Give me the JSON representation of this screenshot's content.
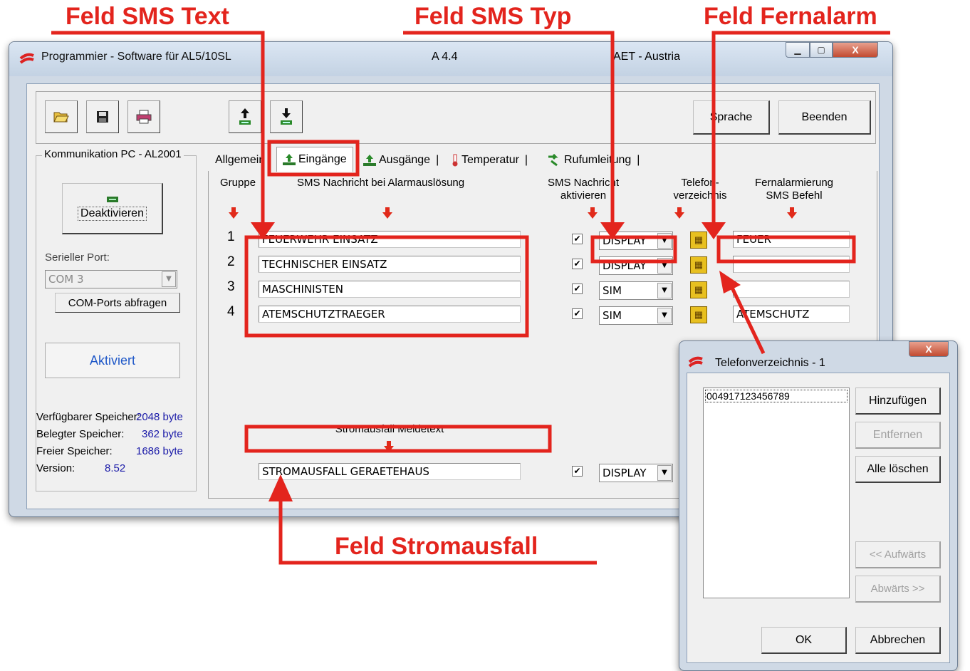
{
  "callouts": {
    "sms_text": "Feld SMS Text",
    "sms_typ": "Feld SMS Typ",
    "fernalarm": "Feld Fernalarm",
    "stromausfall": "Feld Stromausfall"
  },
  "colors": {
    "accent_red": "#e3241d",
    "value_blue": "#1a1aa8"
  },
  "window": {
    "title": "Programmier - Software für AL5/10SL",
    "version": "A 4.4",
    "vendor": "AET - Austria",
    "caption_icons": [
      "minimize-icon",
      "maximize-icon",
      "close-icon"
    ],
    "caption_close": "X"
  },
  "toolbar": {
    "icons": [
      "open-folder-icon",
      "save-disk-icon",
      "print-icon",
      "upload-icon",
      "download-icon"
    ],
    "sprache": "Sprache",
    "beenden": "Beenden"
  },
  "left": {
    "group_title": "Kommunikation PC - AL2001",
    "deaktivieren": "Deaktivieren",
    "port_label": "Serieller Port:",
    "port_value": "COM 3",
    "ports_button": "COM-Ports abfragen",
    "status": "Aktiviert",
    "mem": [
      {
        "label": "Verfügbarer Speicher:",
        "value": "2048 byte"
      },
      {
        "label": "Belegter Speicher:",
        "value": "362 byte"
      },
      {
        "label": "Freier Speicher:",
        "value": "1686 byte"
      },
      {
        "label": "Version:",
        "value": "8.52"
      }
    ]
  },
  "tabs": [
    "Allgemein",
    "Eingänge",
    "Ausgänge",
    "Temperatur",
    "Rufumleitung"
  ],
  "headers": {
    "gruppe": "Gruppe",
    "sms_msg": "SMS Nachricht bei Alarmauslösung",
    "sms_act_1": "SMS Nachricht",
    "sms_act_2": "aktivieren",
    "tel_1": "Telefon-",
    "tel_2": "verzeichnis",
    "fern_1": "Fernalarmierung",
    "fern_2": "SMS Befehl"
  },
  "rows": [
    {
      "no": "1",
      "text": "FEUERWEHR EINSATZ",
      "checked": "✔",
      "typ": "DISPLAY",
      "fern": "FEUER"
    },
    {
      "no": "2",
      "text": "TECHNISCHER EINSATZ",
      "checked": "✔",
      "typ": "DISPLAY",
      "fern": ""
    },
    {
      "no": "3",
      "text": "MASCHINISTEN",
      "checked": "✔",
      "typ": "SIM",
      "fern": ""
    },
    {
      "no": "4",
      "text": "ATEMSCHUTZTRAEGER",
      "checked": "✔",
      "typ": "SIM",
      "fern": "ATEMSCHUTZ"
    }
  ],
  "strom": {
    "label": "Stromausfall Meldetext",
    "text": "STROMAUSFALL GERAETEHAUS",
    "checked": "✔",
    "typ": "DISPLAY"
  },
  "dialog": {
    "title": "Telefonverzeichnis - 1",
    "close": "X",
    "entry": "004917123456789",
    "hinzufuegen": "Hinzufügen",
    "entfernen": "Entfernen",
    "alle_loeschen": "Alle löschen",
    "aufwaerts": "<< Aufwärts",
    "abwaerts": "Abwärts >>",
    "ok": "OK",
    "abbrechen": "Abbrechen"
  }
}
